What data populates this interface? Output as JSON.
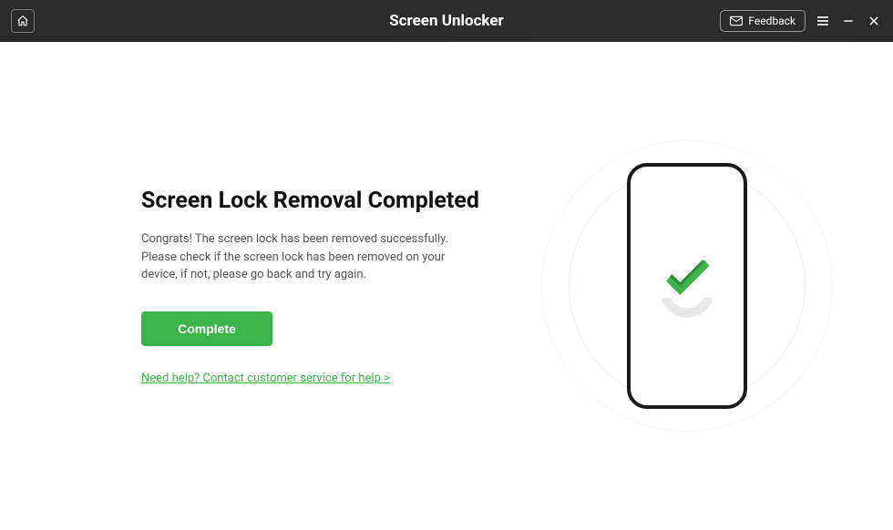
{
  "titlebar": {
    "app_title": "Screen Unlocker",
    "feedback_label": "Feedback"
  },
  "main": {
    "heading": "Screen Lock Removal Completed",
    "description": "Congrats! The screen lock has been removed successfully. Please check if the screen lock has been removed on your device, if not, please go back and try again.",
    "complete_label": "Complete",
    "help_link": "Need help? Contact customer service for help  >"
  },
  "colors": {
    "accent": "#3bb54a"
  }
}
